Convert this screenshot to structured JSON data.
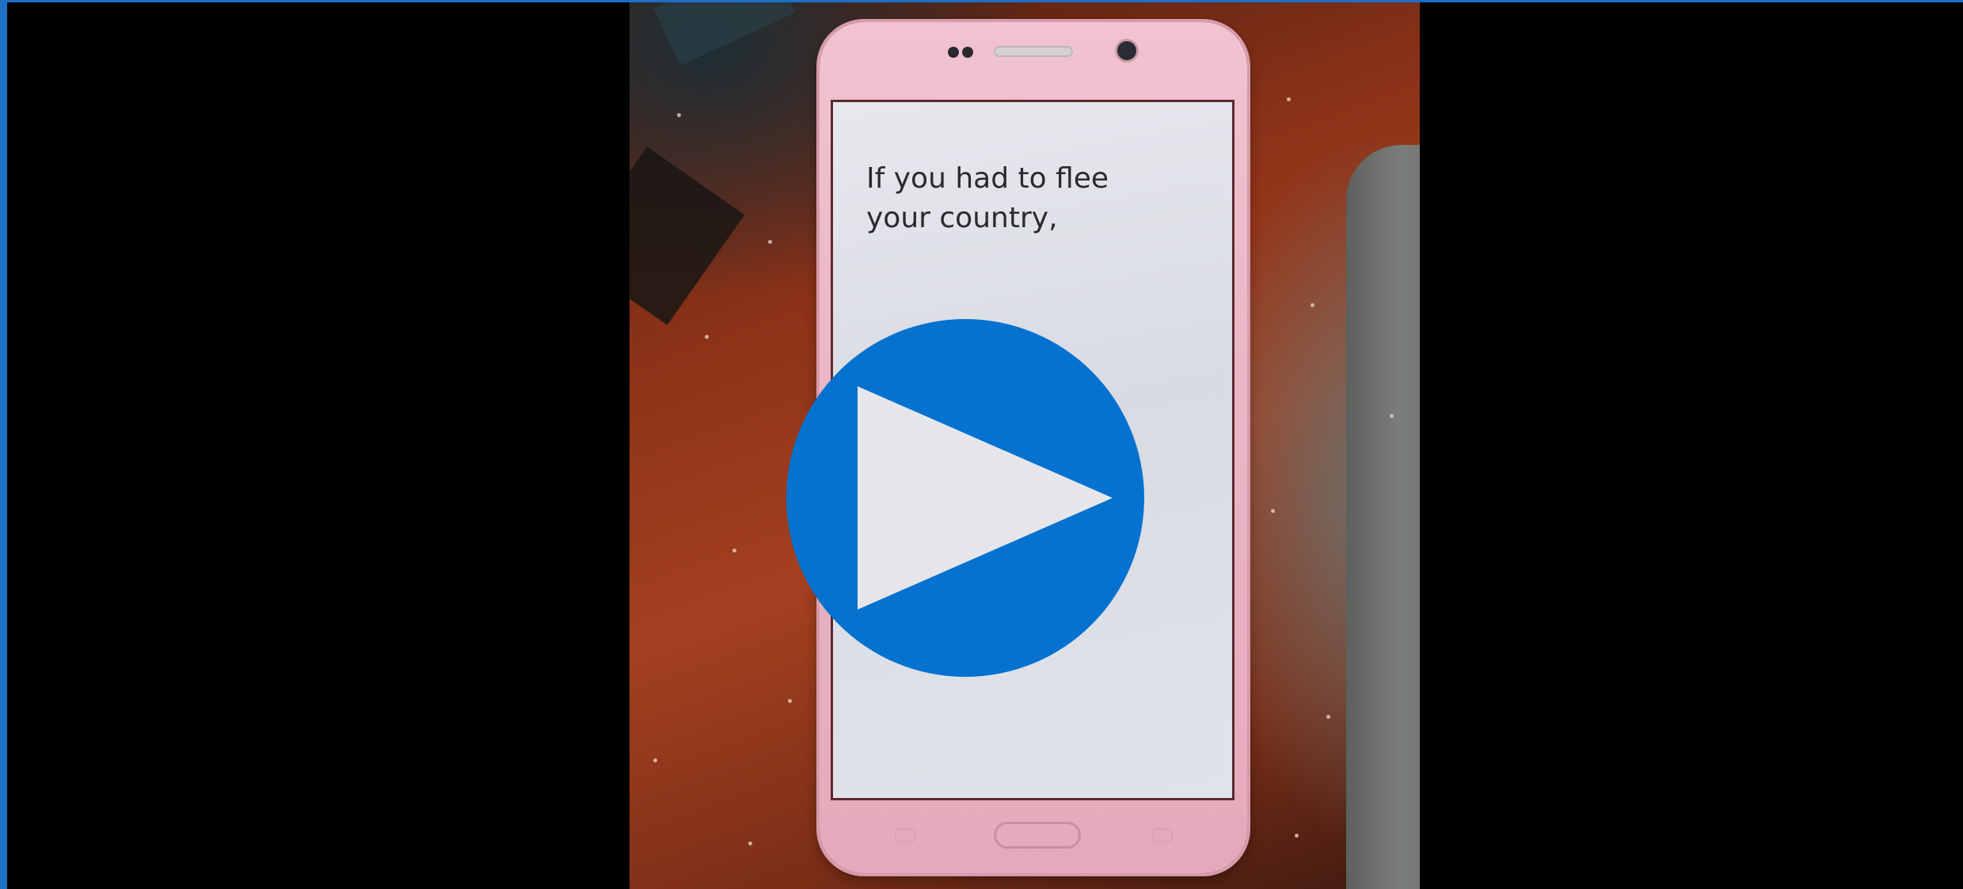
{
  "video": {
    "caption": "If you had to flee\nyour country,"
  },
  "play_control": {
    "icon": "play-icon",
    "color": "#0572d0"
  },
  "colors": {
    "frame_border": "#1f6fc7",
    "background": "#000000"
  }
}
